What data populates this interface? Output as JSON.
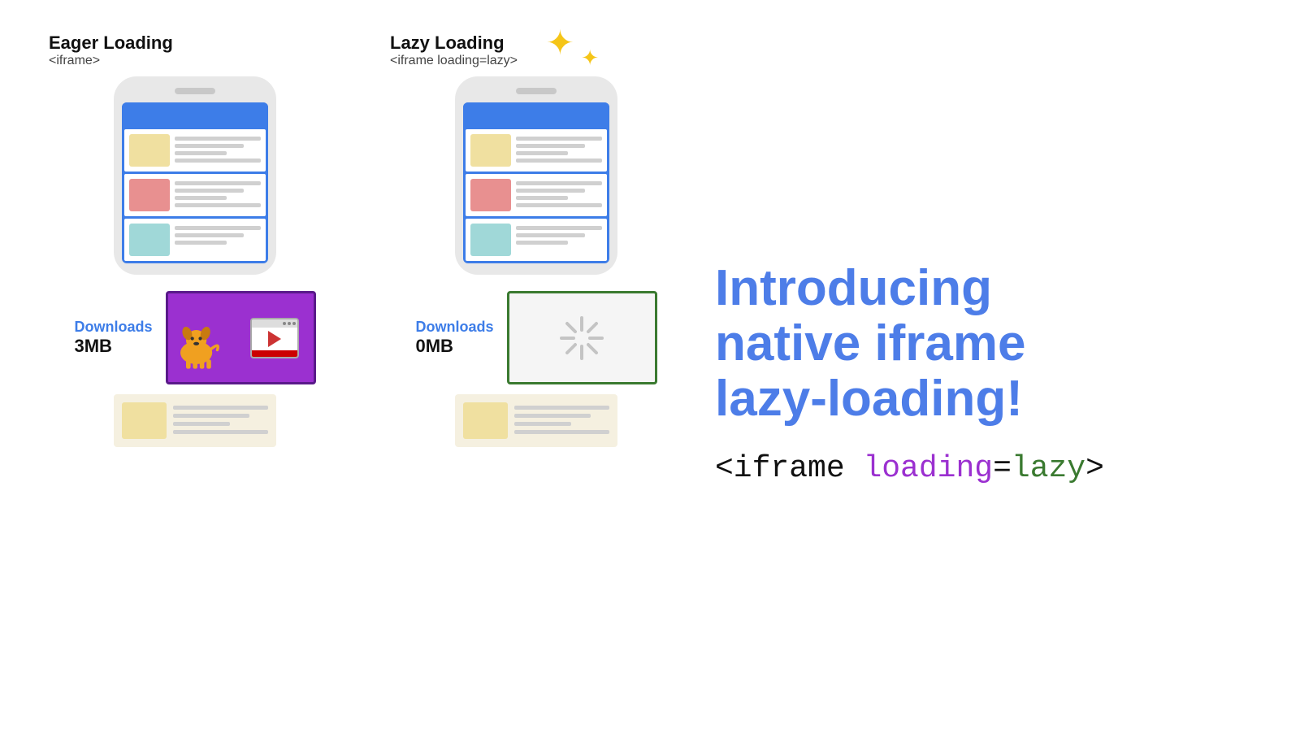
{
  "eager": {
    "title": "Eager Loading",
    "subtitle": "<iframe>",
    "downloads_label": "Downloads",
    "downloads_size": "3MB"
  },
  "lazy": {
    "title": "Lazy Loading",
    "subtitle": "<iframe loading=lazy>",
    "downloads_label": "Downloads",
    "downloads_size": "0MB"
  },
  "right": {
    "intro_line1": "Introducing",
    "intro_line2": "native iframe",
    "intro_line3": "lazy-loading!",
    "code_prefix": "<iframe ",
    "code_attr": "loading",
    "code_eq": "=",
    "code_val": "lazy",
    "code_suffix": ">"
  }
}
